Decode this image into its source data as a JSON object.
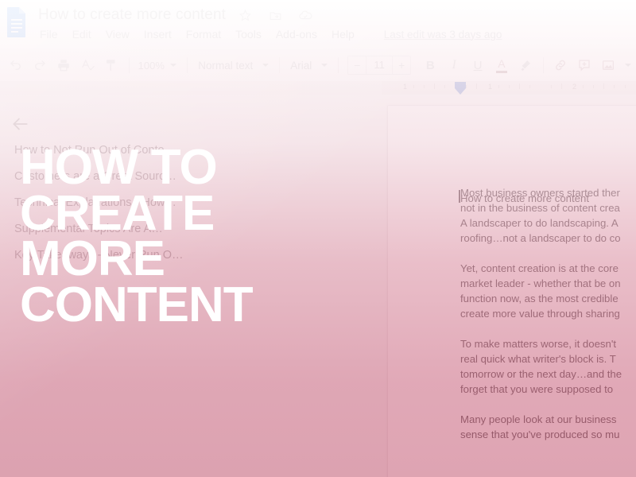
{
  "app": {
    "name": "Google Docs",
    "logo_icon": "google-docs-icon"
  },
  "titlebar": {
    "doc_title": "How to create more content",
    "icons": [
      {
        "name": "star-icon",
        "label": "Star"
      },
      {
        "name": "move-to-folder-icon",
        "label": "Move to folder"
      },
      {
        "name": "cloud-saved-icon",
        "label": "Saved to Drive"
      }
    ],
    "menu": [
      "File",
      "Edit",
      "View",
      "Insert",
      "Format",
      "Tools",
      "Add-ons",
      "Help"
    ],
    "last_edit": "Last edit was 3 days ago"
  },
  "toolbar": {
    "undo": "undo-icon",
    "redo": "redo-icon",
    "print": "print-icon",
    "spellcheck": "spellcheck-icon",
    "paint_format": "paint-format-icon",
    "zoom_value": "100%",
    "paragraph_style": "Normal text",
    "font_family": "Arial",
    "font_size": "11",
    "decrease_label": "−",
    "increase_label": "+",
    "bold": "B",
    "italic": "I",
    "underline": "U",
    "text_color": "A",
    "text_color_swatch": "#b99ba0",
    "highlight": "highlighter-icon",
    "insert_link": "link-icon",
    "add_comment": "add-comment-icon",
    "insert_image": "insert-image-icon"
  },
  "ruler": {
    "numbers": [
      "1",
      "1",
      "2"
    ],
    "indent_marker": "left-indent-marker"
  },
  "outline": {
    "back_label": "back-arrow",
    "items": [
      "How to Not Run Out of Conte…",
      "Customers are a Great Sourc…",
      "Technical Explanations - How…",
      "Supplemental Topics Are A…",
      "Key Takeaways - Never Run O…"
    ]
  },
  "document": {
    "heading": "How to create more content",
    "paragraphs": [
      "Most business owners started ther\nnot in the business of content crea\nA landscaper to do landscaping. A\nroofing…not a landscaper to do co",
      "Yet, content creation is at the core\nmarket leader - whether that be on\nfunction now, as the most credible\ncreate more value through sharing",
      "To make matters worse, it doesn't\nreal quick what writer's block is. T\ntomorrow or the next day…and the\nforget that you were supposed to",
      "Many people look at our business\nsense that you've produced so mu"
    ]
  },
  "overlay": {
    "lines": [
      "HOW TO",
      "CREATE",
      "MORE",
      "CONTENT"
    ],
    "text_color": "#ffffff",
    "gradient_top": "#ffffff",
    "gradient_bottom": "#c8647d"
  }
}
